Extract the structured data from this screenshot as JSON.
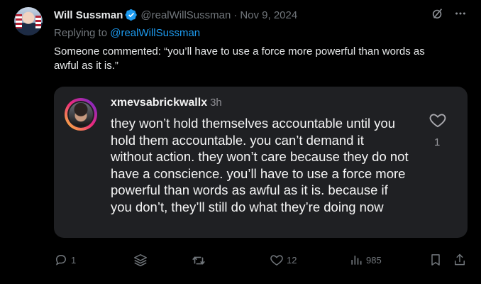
{
  "post": {
    "author_name": "Will Sussman",
    "author_handle": "@realWillSussman",
    "separator": "·",
    "date": "Nov 9, 2024",
    "replying_prefix": "Replying to",
    "replying_handle": "@realWillSussman",
    "text": "Someone commented: “you’ll have to use a force more powerful than words as awful as it is.”"
  },
  "quote": {
    "username": "xmevsabrickwallx",
    "time": "3h",
    "text": "they won’t hold themselves accountable until you hold them accountable. you can’t demand it without action. they won’t care because they do not have a conscience. you’ll have to use a force more powerful than words as awful as it is. because if you don’t, they’ll still do what they’re doing now",
    "like_count": "1"
  },
  "actions": {
    "replies": "1",
    "likes": "12",
    "views": "985"
  },
  "colors": {
    "background": "#000000",
    "link": "#1d9bf0",
    "verified": "#1d9bf0",
    "muted": "#71767b",
    "card": "#1f2023"
  },
  "icons": [
    "verified-badge-icon",
    "grok-icon",
    "more-icon",
    "reply-icon",
    "layers-icon",
    "retweet-icon",
    "like-icon",
    "views-icon",
    "bookmark-icon",
    "share-icon",
    "heart-icon"
  ]
}
